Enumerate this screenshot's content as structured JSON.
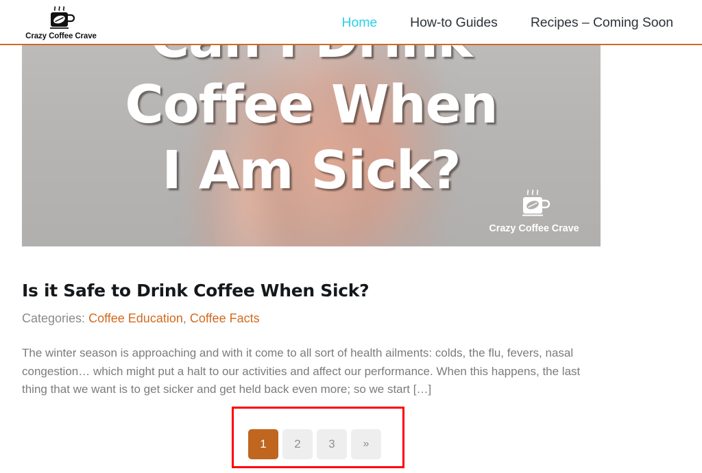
{
  "header": {
    "brand": {
      "name": "Crazy Coffee Crave",
      "logo_icon": "coffee-mug-icon"
    },
    "nav": [
      {
        "label": "Home",
        "active": true
      },
      {
        "label": "How-to Guides",
        "active": false
      },
      {
        "label": "Recipes – Coming Soon",
        "active": false
      }
    ],
    "accent_color": "#d2691e",
    "active_nav_color": "#2ad2e6"
  },
  "hero": {
    "overlay_title": "Can I Drink\nCoffee When\nI Am Sick?",
    "watermark": {
      "text": "Crazy Coffee Crave",
      "icon": "coffee-mug-icon"
    }
  },
  "article": {
    "title": "Is it Safe to Drink Coffee When Sick?",
    "categories_label": "Categories:",
    "categories": [
      {
        "label": "Coffee Education"
      },
      {
        "label": "Coffee Facts"
      }
    ],
    "category_separator": ", ",
    "excerpt": "The winter season is approaching and with it come to all sort of health ailments: colds, the flu, fevers, nasal congestion… which might put a halt to our activities and affect our performance. When this happens, the last thing that we want is to get sicker and get held back even more; so we start […]",
    "link_color": "#d2691e"
  },
  "pagination": {
    "pages": [
      {
        "label": "1",
        "current": true
      },
      {
        "label": "2",
        "current": false
      },
      {
        "label": "3",
        "current": false
      },
      {
        "label": "»",
        "current": false,
        "is_next": true
      }
    ],
    "current_bg": "#c0661f",
    "inactive_bg": "#eeeeee",
    "highlight_color": "#ff0000"
  }
}
